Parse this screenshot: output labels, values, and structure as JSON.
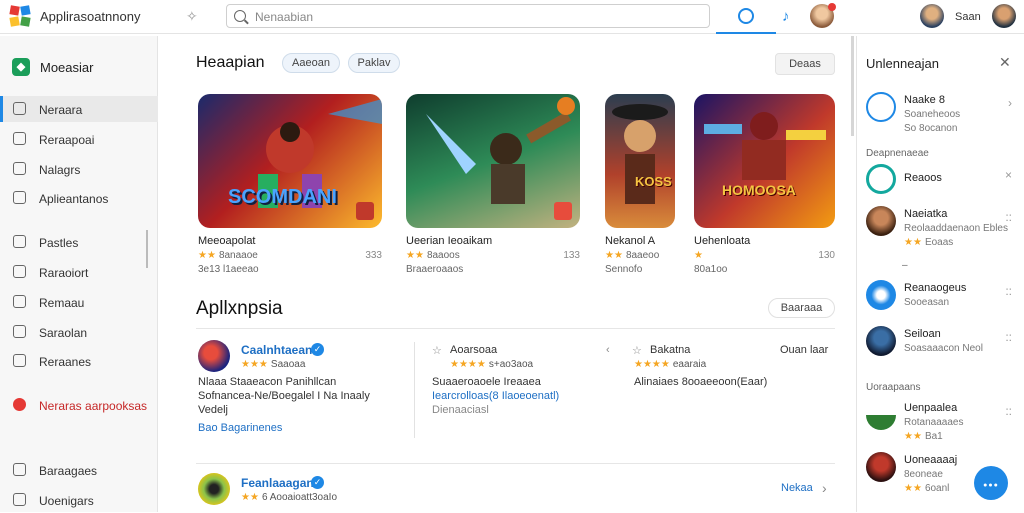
{
  "app": {
    "title": "Applirasoatnnony",
    "search_placeholder": "Nenaabian",
    "username": "Saan"
  },
  "sidebar": {
    "header": "Moeasiar",
    "items": [
      {
        "label": "Neraara",
        "icon": "home-icon",
        "selected": true
      },
      {
        "label": "Reraapoai",
        "icon": "grid-icon"
      },
      {
        "label": "Nalagrs",
        "icon": "tag-icon"
      },
      {
        "label": "Aplieantanos",
        "icon": "apps-icon"
      },
      {
        "label": "Pastles",
        "icon": "puzzle-icon"
      },
      {
        "label": "Raraoiort",
        "icon": "check-icon"
      },
      {
        "label": "Remaau",
        "icon": "people-icon"
      },
      {
        "label": "Saraolan",
        "icon": "circle-icon"
      },
      {
        "label": "Reraanes",
        "icon": "info-icon"
      },
      {
        "label": "Neraras aarpooksas",
        "icon": "alert-icon",
        "accent": "#e53935"
      },
      {
        "label": "Baraagaes",
        "icon": "pen-icon"
      },
      {
        "label": "Uoenigars",
        "icon": "person-icon"
      }
    ]
  },
  "games_section": {
    "title": "Heaapian",
    "chips": [
      "Aaeoan",
      "Paklav"
    ],
    "button": "Deaas",
    "games": [
      {
        "name": "Meeoapolat",
        "stars": "★★",
        "rating": "8anaaoe",
        "sub": "3e13 l1aeeao",
        "num": "333",
        "art_title": "SCOMDANI"
      },
      {
        "name": "Ueerian Ieoaikam",
        "stars": "★★",
        "rating": "8aaoos",
        "sub": "Braaeroaaos",
        "num": "133"
      },
      {
        "name": "Nekanol A",
        "stars": "★★",
        "rating": "8aaeoo",
        "sub": "Sennofo",
        "num": "",
        "art_title": "KOSS"
      },
      {
        "name": "Uehenloata",
        "stars": "★",
        "rating": "",
        "sub": "80a1oo",
        "num": "130",
        "art_title": "HOMOOSA"
      }
    ]
  },
  "apps_section": {
    "title": "Apllxnpsia",
    "button": "Baaraaa",
    "apps": [
      {
        "name": "Caalnhtaean",
        "stars": "★★★",
        "rating": "Saaoaa",
        "desc1": "Nlaaa Staaeacon Panihllcan",
        "desc2": "Sofnancea-Ne/Boegalel I Na Inaaly",
        "desc3": "Vedelj",
        "link": "Bao Bagarinenes"
      },
      {
        "name": "Aoarsoaa",
        "stars": "★★★★",
        "rating": "s+ao3aoa",
        "desc1": "Suaaeroaoele Ireaaea",
        "desc2": "Iearcrolloas(8 Ilaoeoenatl)",
        "desc3": "Dienaaciasl"
      },
      {
        "name": "Bakatna",
        "stars": "★★★★",
        "rating": "eaaraia",
        "desc1": "Alinaiaes 8ooaeeoon(Eaar)",
        "extra": "Ouan laar"
      },
      {
        "name": "Feanlaaagan",
        "stars": "★★",
        "rating": "6 Aooaioatt3oaIo",
        "link": "Nekaa"
      }
    ]
  },
  "right_panel": {
    "title": "Unlenneajan",
    "subtitle1": "Deapnenaeae",
    "subtitle2": "Uoraapaans",
    "items": [
      {
        "name": "Naake 8",
        "desc": "Soaneheoos",
        "sub": "So 8ocanon",
        "stars": "",
        "marker": "›"
      },
      {
        "name": "Reaoos",
        "desc": "",
        "stars": "",
        "marker": "×"
      },
      {
        "name": "Naeiatka",
        "desc": "Reolaaddaenaon Ebles",
        "stars": "★★",
        "rating": "Eoaas",
        "marker": "::"
      },
      {
        "name": "Reanaogeus",
        "desc": "Sooeasan",
        "stars": "",
        "marker": "::"
      },
      {
        "name": "Seiloan",
        "desc": "Soasaaacon Neol",
        "stars": "",
        "marker": "::"
      },
      {
        "name": "Uenpaalea",
        "desc": "Rotanaaaaes",
        "stars": "★★",
        "rating": "Ba1",
        "marker": "::"
      },
      {
        "name": "Uoneaaaaj",
        "desc": "8eoneae",
        "stars": "★★",
        "rating": "6oanl",
        "marker": "::"
      }
    ]
  },
  "colors": {
    "accent": "#1e88e5",
    "star": "#f5a623",
    "brand_green": "#1b9e5a",
    "alert": "#e53935"
  }
}
